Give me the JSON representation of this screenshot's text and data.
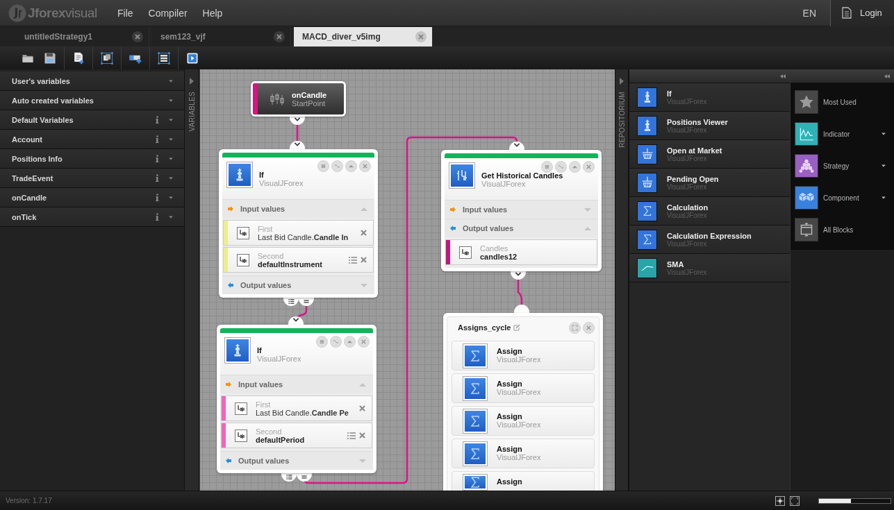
{
  "header": {
    "logo": "**Jforex**visual",
    "menu": [
      "File",
      "Compiler",
      "Help"
    ],
    "language": "EN",
    "login": "Login"
  },
  "tabs": [
    {
      "label": "untitledStrategy1",
      "selected": false
    },
    {
      "label": "sem123_vjf",
      "selected": false
    },
    {
      "label": "MACD_diver_v5img",
      "selected": true
    }
  ],
  "variables": {
    "strip_label": "VARIABLES",
    "items": [
      {
        "label": "User's variables",
        "info": false
      },
      {
        "label": "Auto created variables",
        "info": false
      },
      {
        "label": "Default Variables",
        "info": true
      },
      {
        "label": "Account",
        "info": true
      },
      {
        "label": "Positions Info",
        "info": true
      },
      {
        "label": "TradeEvent",
        "info": true
      },
      {
        "label": "onCandle",
        "info": true
      },
      {
        "label": "onTick",
        "info": true
      }
    ]
  },
  "canvas": {
    "start": {
      "title": "onCandle",
      "subtitle": "StartPoint"
    },
    "blocks": [
      {
        "title": "If",
        "subtitle": "VisualJForex",
        "kind": "chess",
        "sections": [
          {
            "kind": "input",
            "label": "Input values",
            "expanded": true,
            "params": [
              {
                "kind": "field",
                "label": "First",
                "value": "Last Bid Candle.**Candle In**",
                "color": "#eeee88",
                "list": false,
                "removable": true
              },
              {
                "kind": "variable",
                "label": "Second",
                "value": "defaultInstrument",
                "color": "#eeee88",
                "list": true,
                "removable": true
              }
            ]
          },
          {
            "kind": "output",
            "label": "Output values",
            "expanded": false
          }
        ]
      },
      {
        "title": "Get Historical Candles",
        "subtitle": "VisualJForex",
        "kind": "candles",
        "sections": [
          {
            "kind": "input",
            "label": "Input values",
            "expanded": false
          },
          {
            "kind": "output",
            "label": "Output values",
            "expanded": true,
            "params": [
              {
                "kind": "variable",
                "label": "Candles",
                "value": "candles12",
                "color": "#c2187a",
                "list": false,
                "removable": false
              }
            ]
          }
        ]
      },
      {
        "title": "If",
        "subtitle": "VisualJForex",
        "kind": "chess",
        "sections": [
          {
            "kind": "input",
            "label": "Input values",
            "expanded": true,
            "params": [
              {
                "kind": "field",
                "label": "First",
                "value": "Last Bid Candle.**Candle Pe**",
                "color": "#ee66bb",
                "list": false,
                "removable": true
              },
              {
                "kind": "variable",
                "label": "Second",
                "value": "defaultPeriod",
                "color": "#ee66bb",
                "list": true,
                "removable": true
              }
            ]
          },
          {
            "kind": "output",
            "label": "Output values",
            "expanded": false
          }
        ]
      }
    ],
    "group": {
      "title": "Assigns_cycle",
      "items": [
        {
          "title": "Assign",
          "subtitle": "VisualJForex",
          "kind": "sigma"
        },
        {
          "title": "Assign",
          "subtitle": "VisualJForex",
          "kind": "sigma"
        },
        {
          "title": "Assign",
          "subtitle": "VisualJForex",
          "kind": "sigma"
        },
        {
          "title": "Assign",
          "subtitle": "VisualJForex",
          "kind": "sigma"
        },
        {
          "title": "Assign",
          "kind": "sigma"
        }
      ]
    }
  },
  "repository": {
    "strip_label": "REPOSITORIUM",
    "items": [
      {
        "title": "If",
        "subtitle": "VisualJForex",
        "kind": "chess",
        "color": "#3274d9"
      },
      {
        "title": "Positions Viewer",
        "subtitle": "VisualJForex",
        "kind": "chess",
        "color": "#3274d9"
      },
      {
        "title": "Open at Market",
        "subtitle": "VisualJForex",
        "kind": "basket",
        "color": "#3274d9"
      },
      {
        "title": "Pending Open",
        "subtitle": "VisualJForex",
        "kind": "basket",
        "color": "#3274d9"
      },
      {
        "title": "Calculation",
        "subtitle": "VisualJForex",
        "kind": "sigma",
        "color": "#3274d9"
      },
      {
        "title": "Calculation Expression",
        "subtitle": "VisualJForex",
        "kind": "sigma",
        "color": "#3274d9"
      },
      {
        "title": "SMA",
        "subtitle": "VisualJForex",
        "kind": "wave",
        "color": "#2aa4a9"
      }
    ]
  },
  "categories": [
    {
      "label": "Most Used",
      "kind": "star",
      "color": "#474747",
      "expandable": false
    },
    {
      "label": "Indicator",
      "kind": "chart",
      "color": "#2fb1b6",
      "expandable": true
    },
    {
      "label": "Strategy",
      "kind": "pyramid",
      "color": "#9a5fc2",
      "expandable": true
    },
    {
      "label": "Component",
      "kind": "cubes",
      "color": "#3a80dd",
      "expandable": true
    },
    {
      "label": "All Blocks",
      "kind": "window",
      "color": "#474747",
      "expandable": false
    }
  ],
  "status_bar": {
    "version": "Version: 1.7.17",
    "zoom": {
      "level": 0.45
    }
  }
}
